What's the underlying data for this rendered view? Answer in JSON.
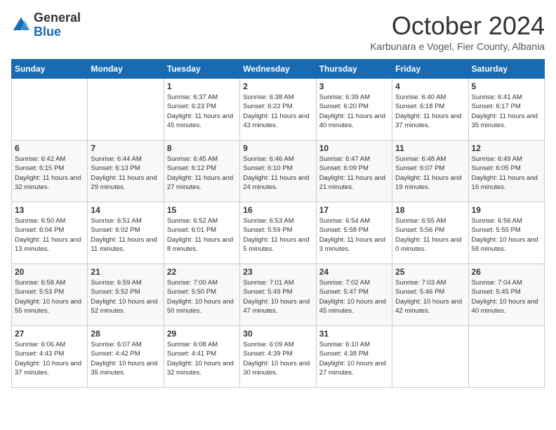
{
  "logo": {
    "general": "General",
    "blue": "Blue"
  },
  "header": {
    "month": "October 2024",
    "location": "Karbunara e Vogel, Fier County, Albania"
  },
  "weekdays": [
    "Sunday",
    "Monday",
    "Tuesday",
    "Wednesday",
    "Thursday",
    "Friday",
    "Saturday"
  ],
  "weeks": [
    [
      {
        "num": "",
        "info": ""
      },
      {
        "num": "",
        "info": ""
      },
      {
        "num": "1",
        "info": "Sunrise: 6:37 AM\nSunset: 6:23 PM\nDaylight: 11 hours and 45 minutes."
      },
      {
        "num": "2",
        "info": "Sunrise: 6:38 AM\nSunset: 6:22 PM\nDaylight: 11 hours and 43 minutes."
      },
      {
        "num": "3",
        "info": "Sunrise: 6:39 AM\nSunset: 6:20 PM\nDaylight: 11 hours and 40 minutes."
      },
      {
        "num": "4",
        "info": "Sunrise: 6:40 AM\nSunset: 6:18 PM\nDaylight: 11 hours and 37 minutes."
      },
      {
        "num": "5",
        "info": "Sunrise: 6:41 AM\nSunset: 6:17 PM\nDaylight: 11 hours and 35 minutes."
      }
    ],
    [
      {
        "num": "6",
        "info": "Sunrise: 6:42 AM\nSunset: 6:15 PM\nDaylight: 11 hours and 32 minutes."
      },
      {
        "num": "7",
        "info": "Sunrise: 6:44 AM\nSunset: 6:13 PM\nDaylight: 11 hours and 29 minutes."
      },
      {
        "num": "8",
        "info": "Sunrise: 6:45 AM\nSunset: 6:12 PM\nDaylight: 11 hours and 27 minutes."
      },
      {
        "num": "9",
        "info": "Sunrise: 6:46 AM\nSunset: 6:10 PM\nDaylight: 11 hours and 24 minutes."
      },
      {
        "num": "10",
        "info": "Sunrise: 6:47 AM\nSunset: 6:09 PM\nDaylight: 11 hours and 21 minutes."
      },
      {
        "num": "11",
        "info": "Sunrise: 6:48 AM\nSunset: 6:07 PM\nDaylight: 11 hours and 19 minutes."
      },
      {
        "num": "12",
        "info": "Sunrise: 6:49 AM\nSunset: 6:05 PM\nDaylight: 11 hours and 16 minutes."
      }
    ],
    [
      {
        "num": "13",
        "info": "Sunrise: 6:50 AM\nSunset: 6:04 PM\nDaylight: 11 hours and 13 minutes."
      },
      {
        "num": "14",
        "info": "Sunrise: 6:51 AM\nSunset: 6:02 PM\nDaylight: 11 hours and 11 minutes."
      },
      {
        "num": "15",
        "info": "Sunrise: 6:52 AM\nSunset: 6:01 PM\nDaylight: 11 hours and 8 minutes."
      },
      {
        "num": "16",
        "info": "Sunrise: 6:53 AM\nSunset: 5:59 PM\nDaylight: 11 hours and 5 minutes."
      },
      {
        "num": "17",
        "info": "Sunrise: 6:54 AM\nSunset: 5:58 PM\nDaylight: 11 hours and 3 minutes."
      },
      {
        "num": "18",
        "info": "Sunrise: 6:55 AM\nSunset: 5:56 PM\nDaylight: 11 hours and 0 minutes."
      },
      {
        "num": "19",
        "info": "Sunrise: 6:56 AM\nSunset: 5:55 PM\nDaylight: 10 hours and 58 minutes."
      }
    ],
    [
      {
        "num": "20",
        "info": "Sunrise: 6:58 AM\nSunset: 5:53 PM\nDaylight: 10 hours and 55 minutes."
      },
      {
        "num": "21",
        "info": "Sunrise: 6:59 AM\nSunset: 5:52 PM\nDaylight: 10 hours and 52 minutes."
      },
      {
        "num": "22",
        "info": "Sunrise: 7:00 AM\nSunset: 5:50 PM\nDaylight: 10 hours and 50 minutes."
      },
      {
        "num": "23",
        "info": "Sunrise: 7:01 AM\nSunset: 5:49 PM\nDaylight: 10 hours and 47 minutes."
      },
      {
        "num": "24",
        "info": "Sunrise: 7:02 AM\nSunset: 5:47 PM\nDaylight: 10 hours and 45 minutes."
      },
      {
        "num": "25",
        "info": "Sunrise: 7:03 AM\nSunset: 5:46 PM\nDaylight: 10 hours and 42 minutes."
      },
      {
        "num": "26",
        "info": "Sunrise: 7:04 AM\nSunset: 5:45 PM\nDaylight: 10 hours and 40 minutes."
      }
    ],
    [
      {
        "num": "27",
        "info": "Sunrise: 6:06 AM\nSunset: 4:43 PM\nDaylight: 10 hours and 37 minutes."
      },
      {
        "num": "28",
        "info": "Sunrise: 6:07 AM\nSunset: 4:42 PM\nDaylight: 10 hours and 35 minutes."
      },
      {
        "num": "29",
        "info": "Sunrise: 6:08 AM\nSunset: 4:41 PM\nDaylight: 10 hours and 32 minutes."
      },
      {
        "num": "30",
        "info": "Sunrise: 6:09 AM\nSunset: 4:39 PM\nDaylight: 10 hours and 30 minutes."
      },
      {
        "num": "31",
        "info": "Sunrise: 6:10 AM\nSunset: 4:38 PM\nDaylight: 10 hours and 27 minutes."
      },
      {
        "num": "",
        "info": ""
      },
      {
        "num": "",
        "info": ""
      }
    ]
  ]
}
